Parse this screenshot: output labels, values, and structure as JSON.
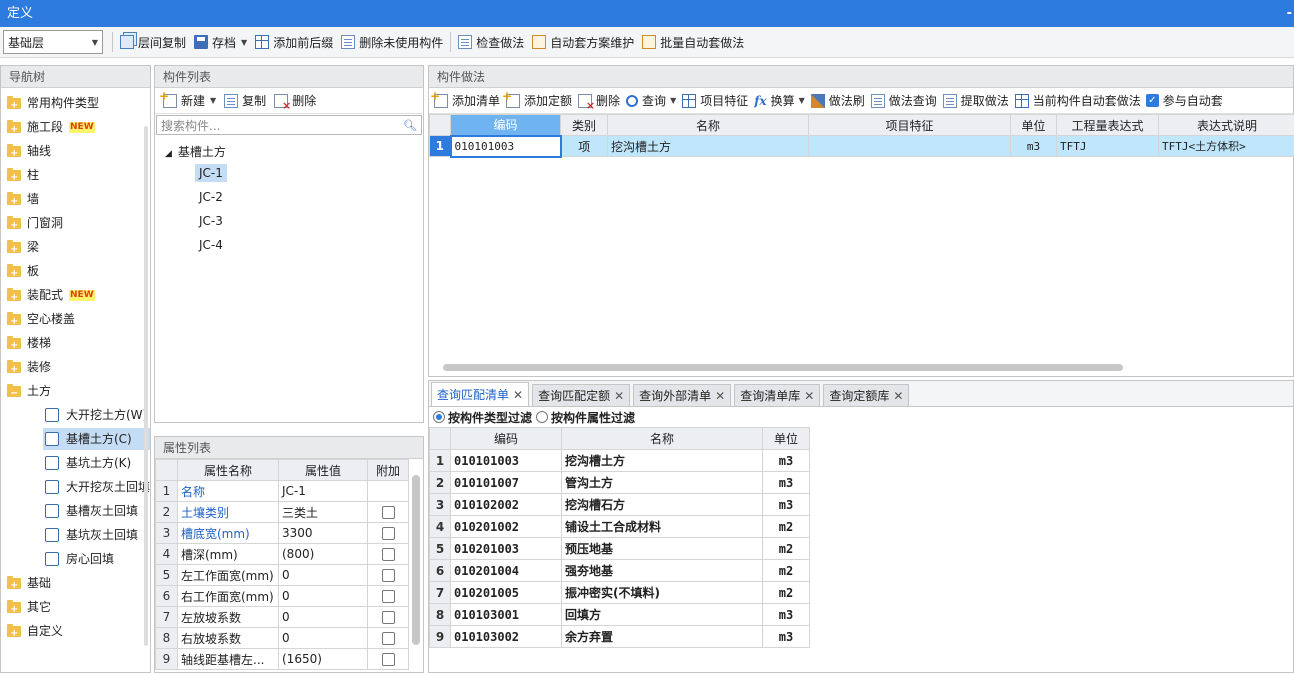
{
  "window": {
    "title": "定义"
  },
  "toolbar": {
    "floor_value": "基础层",
    "buttons": [
      {
        "label": "层间复制",
        "icon": "copy-icon"
      },
      {
        "label": "存档",
        "icon": "save-icon"
      },
      {
        "label": "添加前后缀",
        "icon": "prefix-icon"
      },
      {
        "label": "删除未使用构件",
        "icon": "delete-unused-icon"
      },
      {
        "label": "检查做法",
        "icon": "check-method-icon"
      },
      {
        "label": "自动套方案维护",
        "icon": "auto-scheme-icon"
      },
      {
        "label": "批量自动套做法",
        "icon": "batch-auto-icon"
      }
    ]
  },
  "nav": {
    "title": "导航树",
    "items": [
      {
        "label": "常用构件类型"
      },
      {
        "label": "施工段",
        "badge": "NEW"
      },
      {
        "label": "轴线"
      },
      {
        "label": "柱"
      },
      {
        "label": "墙"
      },
      {
        "label": "门窗洞"
      },
      {
        "label": "梁"
      },
      {
        "label": "板"
      },
      {
        "label": "装配式",
        "badge": "NEW"
      },
      {
        "label": "空心楼盖"
      },
      {
        "label": "楼梯"
      },
      {
        "label": "装修"
      },
      {
        "label": "土方"
      }
    ],
    "subitems": [
      {
        "label": "大开挖土方(W)"
      },
      {
        "label": "基槽土方(C)"
      },
      {
        "label": "基坑土方(K)"
      },
      {
        "label": "大开挖灰土回填"
      },
      {
        "label": "基槽灰土回填"
      },
      {
        "label": "基坑灰土回填"
      },
      {
        "label": "房心回填"
      }
    ],
    "bottom_items": [
      {
        "label": "基础"
      },
      {
        "label": "其它"
      },
      {
        "label": "自定义"
      }
    ]
  },
  "components": {
    "title": "构件列表",
    "new_label": "新建",
    "copy_label": "复制",
    "delete_label": "删除",
    "search_placeholder": "搜索构件...",
    "group": "基槽土方",
    "items": [
      "JC-1",
      "JC-2",
      "JC-3",
      "JC-4"
    ]
  },
  "attributes": {
    "title": "属性列表",
    "headers": [
      "属性名称",
      "属性值",
      "附加"
    ],
    "rows": [
      {
        "num": "1",
        "name": "名称",
        "value": "JC-1",
        "blue": true,
        "checkbox": false
      },
      {
        "num": "2",
        "name": "土壤类别",
        "value": "三类土",
        "blue": true,
        "checkbox": true
      },
      {
        "num": "3",
        "name": "槽底宽(mm)",
        "value": "3300",
        "blue": true,
        "checkbox": true
      },
      {
        "num": "4",
        "name": "槽深(mm)",
        "value": "(800)",
        "blue": false,
        "checkbox": true
      },
      {
        "num": "5",
        "name": "左工作面宽(mm)",
        "value": "0",
        "blue": false,
        "checkbox": true
      },
      {
        "num": "6",
        "name": "右工作面宽(mm)",
        "value": "0",
        "blue": false,
        "checkbox": true
      },
      {
        "num": "7",
        "name": "左放坡系数",
        "value": "0",
        "blue": false,
        "checkbox": true
      },
      {
        "num": "8",
        "name": "右放坡系数",
        "value": "0",
        "blue": false,
        "checkbox": true
      },
      {
        "num": "9",
        "name": "轴线距基槽左...",
        "value": "(1650)",
        "blue": false,
        "checkbox": true
      }
    ]
  },
  "method": {
    "title": "构件做法",
    "buttons": [
      "添加清单",
      "添加定额",
      "删除",
      "查询",
      "项目特征",
      "换算",
      "做法刷",
      "做法查询",
      "提取做法",
      "当前构件自动套做法",
      "参与自动套"
    ],
    "headers": [
      "编码",
      "类别",
      "名称",
      "项目特征",
      "单位",
      "工程量表达式",
      "表达式说明"
    ],
    "rows": [
      {
        "num": "1",
        "code": "010101003",
        "type": "项",
        "name": "挖沟槽土方",
        "feature": "",
        "unit": "m3",
        "expr": "TFTJ",
        "desc": "TFTJ<土方体积>"
      }
    ]
  },
  "query": {
    "tabs": [
      "查询匹配清单",
      "查询匹配定额",
      "查询外部清单",
      "查询清单库",
      "查询定额库"
    ],
    "filter_type": "按构件类型过滤",
    "filter_attr": "按构件属性过滤",
    "headers": [
      "编码",
      "名称",
      "单位"
    ],
    "rows": [
      {
        "num": "1",
        "code": "010101003",
        "name": "挖沟槽土方",
        "unit": "m3"
      },
      {
        "num": "2",
        "code": "010101007",
        "name": "管沟土方",
        "unit": "m3"
      },
      {
        "num": "3",
        "code": "010102002",
        "name": "挖沟槽石方",
        "unit": "m3"
      },
      {
        "num": "4",
        "code": "010201002",
        "name": "铺设土工合成材料",
        "unit": "m2"
      },
      {
        "num": "5",
        "code": "010201003",
        "name": "预压地基",
        "unit": "m2"
      },
      {
        "num": "6",
        "code": "010201004",
        "name": "强夯地基",
        "unit": "m2"
      },
      {
        "num": "7",
        "code": "010201005",
        "name": "振冲密实(不填料)",
        "unit": "m2"
      },
      {
        "num": "8",
        "code": "010103001",
        "name": "回填方",
        "unit": "m3"
      },
      {
        "num": "9",
        "code": "010103002",
        "name": "余方弃置",
        "unit": "m3"
      }
    ]
  }
}
